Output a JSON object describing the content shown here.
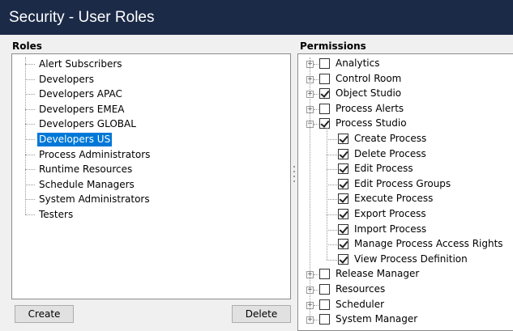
{
  "window": {
    "title": "Security - User Roles"
  },
  "roles": {
    "header": "Roles",
    "items": [
      {
        "label": "Alert Subscribers",
        "selected": false
      },
      {
        "label": "Developers",
        "selected": false
      },
      {
        "label": "Developers APAC",
        "selected": false
      },
      {
        "label": "Developers EMEA",
        "selected": false
      },
      {
        "label": "Developers GLOBAL",
        "selected": false
      },
      {
        "label": "Developers US",
        "selected": true
      },
      {
        "label": "Process Administrators",
        "selected": false
      },
      {
        "label": "Runtime Resources",
        "selected": false
      },
      {
        "label": "Schedule Managers",
        "selected": false
      },
      {
        "label": "System Administrators",
        "selected": false
      },
      {
        "label": "Testers",
        "selected": false
      }
    ],
    "create_label": "Create",
    "delete_label": "Delete"
  },
  "permissions": {
    "header": "Permissions",
    "items": [
      {
        "label": "Analytics",
        "level": 0,
        "expander": "+",
        "checked": false
      },
      {
        "label": "Control Room",
        "level": 0,
        "expander": "+",
        "checked": false
      },
      {
        "label": "Object Studio",
        "level": 0,
        "expander": "+",
        "checked": true
      },
      {
        "label": "Process Alerts",
        "level": 0,
        "expander": "+",
        "checked": false
      },
      {
        "label": "Process Studio",
        "level": 0,
        "expander": "-",
        "checked": true
      },
      {
        "label": "Create Process",
        "level": 1,
        "checked": true
      },
      {
        "label": "Delete Process",
        "level": 1,
        "checked": true
      },
      {
        "label": "Edit Process",
        "level": 1,
        "checked": true
      },
      {
        "label": "Edit Process Groups",
        "level": 1,
        "checked": true
      },
      {
        "label": "Execute Process",
        "level": 1,
        "checked": true
      },
      {
        "label": "Export Process",
        "level": 1,
        "checked": true
      },
      {
        "label": "Import Process",
        "level": 1,
        "checked": true
      },
      {
        "label": "Manage Process Access Rights",
        "level": 1,
        "checked": true
      },
      {
        "label": "View Process Definition",
        "level": 1,
        "checked": true
      },
      {
        "label": "Release Manager",
        "level": 0,
        "expander": "+",
        "checked": false
      },
      {
        "label": "Resources",
        "level": 0,
        "expander": "+",
        "checked": false
      },
      {
        "label": "Scheduler",
        "level": 0,
        "expander": "+",
        "checked": false
      },
      {
        "label": "System Manager",
        "level": 0,
        "expander": "+",
        "checked": false
      }
    ]
  },
  "colors": {
    "titlebar": "#1b2a47",
    "selection": "#0078d7"
  }
}
